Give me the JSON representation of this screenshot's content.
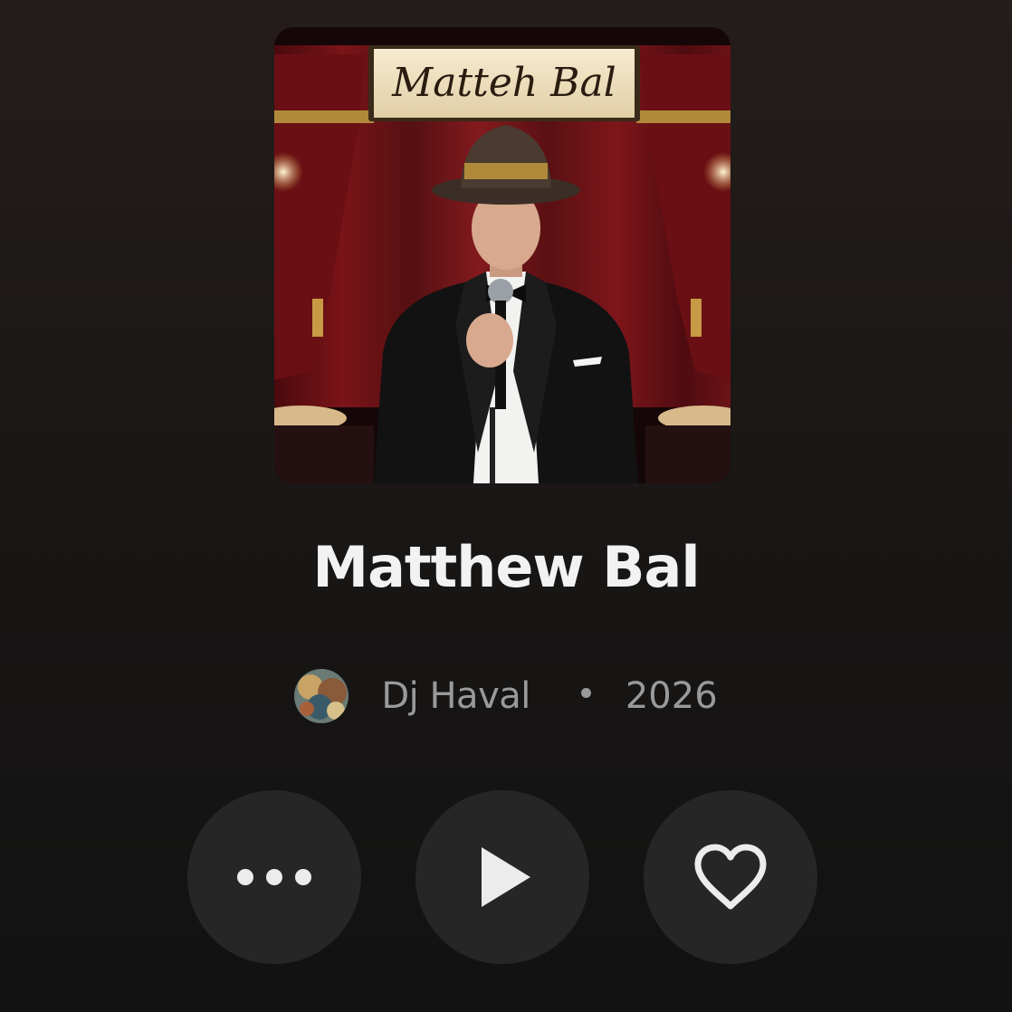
{
  "track": {
    "title": "Matthew Bal",
    "artist": "Dj Haval",
    "year": "2026",
    "artwork_sign_text": "Matteh Bal"
  },
  "controls": {
    "more": {
      "icon": "more-horizontal-icon"
    },
    "play": {
      "icon": "play-icon"
    },
    "like": {
      "icon": "heart-outline-icon"
    }
  },
  "colors": {
    "background_top": "#241d1b",
    "background_bottom": "#121212",
    "title": "#f2f2f2",
    "meta": "#9a9a9a",
    "button_bg": "#262626",
    "icon": "#ececec"
  }
}
